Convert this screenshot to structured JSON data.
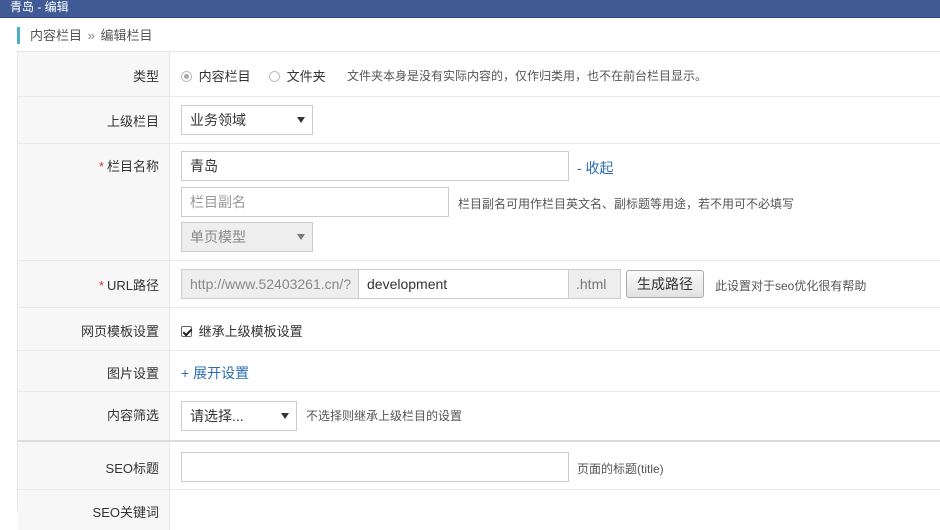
{
  "window": {
    "title": "青岛 - 编辑"
  },
  "breadcrumb": {
    "parent": "内容栏目",
    "separator": "»",
    "current": "编辑栏目"
  },
  "type_row": {
    "label": "类型",
    "option_content": "内容栏目",
    "option_folder": "文件夹",
    "selected": "内容栏目",
    "hint": "文件夹本身是没有实际内容的，仅作归类用，也不在前台栏目显示。"
  },
  "parent_row": {
    "label": "上级栏目",
    "value": "业务领域"
  },
  "name_row": {
    "label": "栏目名称",
    "required_mark": "*",
    "name_value": "青岛",
    "collapse_link": "- 收起",
    "subname_placeholder": "栏目副名",
    "subname_hint": "栏目副名可用作栏目英文名、副标题等用途，若不用可不必填写",
    "model_value": "单页模型"
  },
  "url_row": {
    "label": "URL路径",
    "required_mark": "*",
    "prefix": "http://www.52403261.cn/?",
    "path_value": "development",
    "suffix": ".html",
    "generate_button": "生成路径",
    "hint": "此设置对于seo优化很有帮助"
  },
  "template_row": {
    "label": "网页模板设置",
    "checkbox_label": "继承上级模板设置",
    "checked": true
  },
  "image_row": {
    "label": "图片设置",
    "expand_link": "+ 展开设置"
  },
  "filter_row": {
    "label": "内容筛选",
    "value": "请选择...",
    "hint": "不选择则继承上级栏目的设置"
  },
  "seo_title_row": {
    "label": "SEO标题",
    "value": "",
    "hint": "页面的标题(title)"
  },
  "seo_keywords_row": {
    "label": "SEO关键词"
  }
}
